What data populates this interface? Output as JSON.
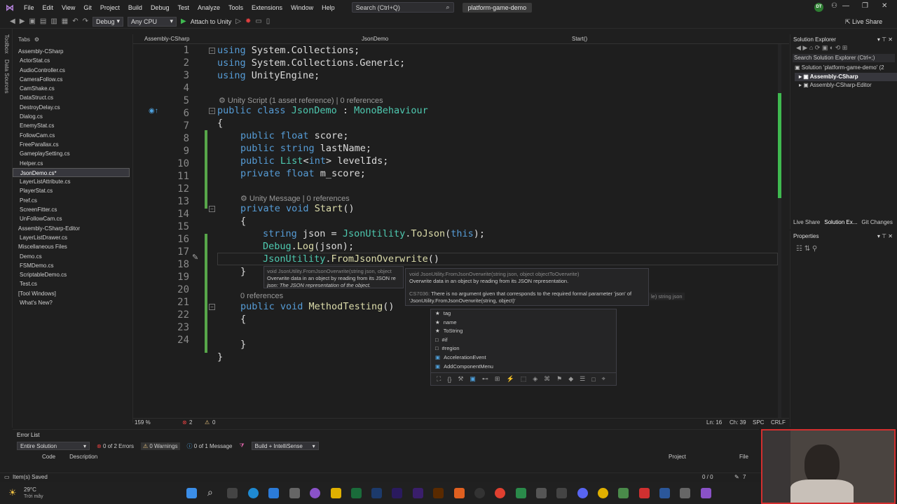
{
  "menubar": {
    "items": [
      "File",
      "Edit",
      "View",
      "Git",
      "Project",
      "Build",
      "Debug",
      "Test",
      "Analyze",
      "Tools",
      "Extensions",
      "Window",
      "Help"
    ],
    "search": "Search (Ctrl+Q)",
    "project": "platform-game-demo",
    "avatar": "DT"
  },
  "toolbar": {
    "config": "Debug",
    "platform": "Any CPU",
    "attach": "Attach to Unity",
    "live_share": "Live Share"
  },
  "left_strip": {
    "toolbox": "Toolbox",
    "data_sources": "Data Sources"
  },
  "tabs_panel": {
    "title": "Tabs",
    "items": [
      {
        "label": "Assembly-CSharp",
        "group": true
      },
      {
        "label": "ActorStat.cs"
      },
      {
        "label": "AudioController.cs"
      },
      {
        "label": "CameraFollow.cs"
      },
      {
        "label": "CamShake.cs"
      },
      {
        "label": "DataStruct.cs"
      },
      {
        "label": "DestroyDelay.cs"
      },
      {
        "label": "Dialog.cs"
      },
      {
        "label": "EnemyStat.cs"
      },
      {
        "label": "FollowCam.cs"
      },
      {
        "label": "FreeParallax.cs"
      },
      {
        "label": "GameplaySetting.cs"
      },
      {
        "label": "Helper.cs"
      },
      {
        "label": "JsonDemo.cs*",
        "selected": true
      },
      {
        "label": "LayerListAttribute.cs"
      },
      {
        "label": "PlayerStat.cs"
      },
      {
        "label": "Pref.cs"
      },
      {
        "label": "ScreenFitter.cs"
      },
      {
        "label": "UnFollowCam.cs"
      },
      {
        "label": "Assembly-CSharp-Editor",
        "group": true
      },
      {
        "label": "LayerListDrawer.cs"
      },
      {
        "label": "Miscellaneous Files",
        "group": true
      },
      {
        "label": "Demo.cs"
      },
      {
        "label": "FSMDemo.cs"
      },
      {
        "label": "ScriptableDemo.cs"
      },
      {
        "label": "Test.cs"
      },
      {
        "label": "[Tool Windows]",
        "group": true
      },
      {
        "label": "What's New?"
      }
    ]
  },
  "editor": {
    "tab_assembly": "Assembly-CSharp",
    "tab_class": "JsonDemo",
    "tab_method": "Start()",
    "line_numbers": [
      "1",
      "2",
      "3",
      "4",
      "5",
      "6",
      "7",
      "8",
      "9",
      "10",
      "11",
      "12",
      "13",
      "14",
      "15",
      "16",
      "17",
      "18",
      "19",
      "20",
      "21",
      "22",
      "23",
      "24"
    ],
    "lens": {
      "unity_script": "Unity Script (1 asset reference) | 0 references",
      "unity_message": "Unity Message | 0 references",
      "zero_refs": "0 references"
    }
  },
  "tooltip": {
    "sig_short": "void JsonUtility.FromJsonOverwrite(string json, object",
    "desc_short": "Overwrite data in an object by reading from its JSON re",
    "param": "json: The JSON representation of the object.",
    "sig_full": "void JsonUtility.FromJsonOverwrite(string json, object objectToOverwrite)",
    "desc_full": "Overwrite data in an object by reading from its JSON representation.",
    "error_code": "CS7036:",
    "error_text": "There is no argument given that corresponds to the required formal parameter 'json' of 'JsonUtility.FromJsonOverwrite(string, object)'",
    "side_hint": "le) string json"
  },
  "completion": {
    "items": [
      "tag",
      "name",
      "ToString",
      "#if",
      "#region",
      "AccelerationEvent",
      "AddComponentMenu"
    ]
  },
  "editor_status": {
    "zoom": "159 %",
    "errors": "2",
    "warnings": "0",
    "position": "Ln: 16",
    "col": "Ch: 39",
    "spc": "SPC",
    "crlf": "CRLF"
  },
  "solution": {
    "title": "Solution Explorer",
    "search": "Search Solution Explorer (Ctrl+;)",
    "root": "Solution 'platform-game-demo' (2",
    "proj1": "Assembly-CSharp",
    "proj2": "Assembly-CSharp-Editor",
    "tab_live": "Live Share",
    "tab_sol": "Solution Ex...",
    "tab_git": "Git Changes"
  },
  "properties": {
    "title": "Properties"
  },
  "error_list": {
    "title": "Error List",
    "scope": "Entire Solution",
    "errors": "0 of 2 Errors",
    "warnings": "0 Warnings",
    "messages": "0 of 1 Message",
    "build": "Build + IntelliSense",
    "col_code": "Code",
    "col_desc": "Description",
    "col_project": "Project",
    "col_file": "File"
  },
  "statusbar": {
    "text": "Item(s) Saved",
    "counts": "0 / 0",
    "pencil": "7"
  },
  "taskbar": {
    "temp": "29°C",
    "weather": "Trời mây"
  },
  "colors": {
    "keyword": "#569cd6",
    "type": "#4ec9b0",
    "method": "#dcdcaa",
    "accent": "#b180d7",
    "change_bar": "#57a64a"
  }
}
